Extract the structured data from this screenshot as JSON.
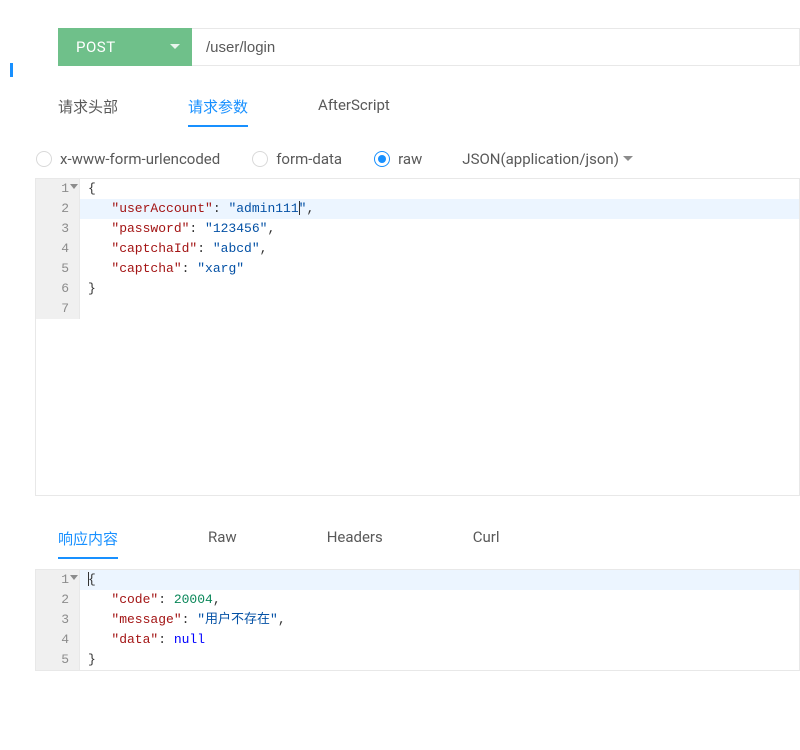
{
  "request": {
    "method": "POST",
    "url": "/user/login"
  },
  "tabs": {
    "headers": "请求头部",
    "params": "请求参数",
    "afterscript": "AfterScript",
    "active": "params"
  },
  "bodyTypes": {
    "urlencoded": "x-www-form-urlencoded",
    "formdata": "form-data",
    "raw": "raw",
    "selected": "raw"
  },
  "contentType": {
    "label": "JSON(application/json)"
  },
  "requestBody": {
    "lines": [
      {
        "n": "1",
        "fold": true,
        "segs": [
          {
            "t": "plain",
            "v": "{"
          }
        ]
      },
      {
        "n": "2",
        "highlight": true,
        "segs": [
          {
            "t": "plain",
            "v": "   "
          },
          {
            "t": "key",
            "v": "\"userAccount\""
          },
          {
            "t": "plain",
            "v": ": "
          },
          {
            "t": "str",
            "v": "\"admin111"
          },
          {
            "t": "cursor"
          },
          {
            "t": "str",
            "v": "\""
          },
          {
            "t": "plain",
            "v": ","
          }
        ]
      },
      {
        "n": "3",
        "segs": [
          {
            "t": "plain",
            "v": "   "
          },
          {
            "t": "key",
            "v": "\"password\""
          },
          {
            "t": "plain",
            "v": ": "
          },
          {
            "t": "str",
            "v": "\"123456\""
          },
          {
            "t": "plain",
            "v": ","
          }
        ]
      },
      {
        "n": "4",
        "segs": [
          {
            "t": "plain",
            "v": "   "
          },
          {
            "t": "key",
            "v": "\"captchaId\""
          },
          {
            "t": "plain",
            "v": ": "
          },
          {
            "t": "str",
            "v": "\"abcd\""
          },
          {
            "t": "plain",
            "v": ","
          }
        ]
      },
      {
        "n": "5",
        "segs": [
          {
            "t": "plain",
            "v": "   "
          },
          {
            "t": "key",
            "v": "\"captcha\""
          },
          {
            "t": "plain",
            "v": ": "
          },
          {
            "t": "str",
            "v": "\"xarg\""
          }
        ]
      },
      {
        "n": "6",
        "segs": [
          {
            "t": "plain",
            "v": "}"
          }
        ]
      },
      {
        "n": "7",
        "segs": [
          {
            "t": "plain",
            "v": ""
          }
        ]
      }
    ]
  },
  "responseTabs": {
    "content": "响应内容",
    "raw": "Raw",
    "headers": "Headers",
    "curl": "Curl",
    "active": "content"
  },
  "responseBody": {
    "lines": [
      {
        "n": "1",
        "fold": true,
        "highlight": true,
        "cursorStart": true,
        "segs": [
          {
            "t": "plain",
            "v": "{"
          }
        ]
      },
      {
        "n": "2",
        "segs": [
          {
            "t": "plain",
            "v": "   "
          },
          {
            "t": "key",
            "v": "\"code\""
          },
          {
            "t": "plain",
            "v": ": "
          },
          {
            "t": "num",
            "v": "20004"
          },
          {
            "t": "plain",
            "v": ","
          }
        ]
      },
      {
        "n": "3",
        "segs": [
          {
            "t": "plain",
            "v": "   "
          },
          {
            "t": "key",
            "v": "\"message\""
          },
          {
            "t": "plain",
            "v": ": "
          },
          {
            "t": "str",
            "v": "\"用户不存在\""
          },
          {
            "t": "plain",
            "v": ","
          }
        ]
      },
      {
        "n": "4",
        "segs": [
          {
            "t": "plain",
            "v": "   "
          },
          {
            "t": "key",
            "v": "\"data\""
          },
          {
            "t": "plain",
            "v": ": "
          },
          {
            "t": "null",
            "v": "null"
          }
        ]
      },
      {
        "n": "5",
        "segs": [
          {
            "t": "plain",
            "v": "}"
          }
        ]
      }
    ]
  }
}
